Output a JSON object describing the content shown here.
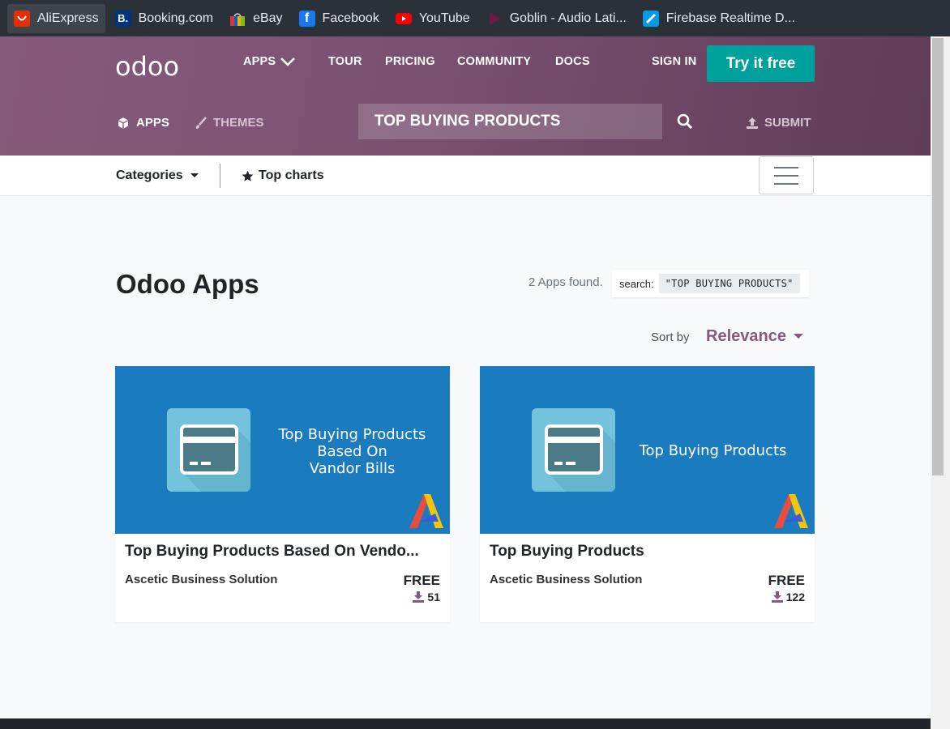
{
  "bookmarks": [
    {
      "label": "AliExpress",
      "icon": "aliexpress-icon",
      "color": "#e62e04"
    },
    {
      "label": "Booking.com",
      "icon": "booking-icon",
      "color": "#003580"
    },
    {
      "label": "eBay",
      "icon": "ebay-icon",
      "color": "#e53238"
    },
    {
      "label": "Facebook",
      "icon": "facebook-icon",
      "color": "#1877f2"
    },
    {
      "label": "YouTube",
      "icon": "youtube-icon",
      "color": "#ff0000"
    },
    {
      "label": "Goblin - Audio Lati...",
      "icon": "goblin-icon",
      "color": "#7b1f4f"
    },
    {
      "label": "Firebase Realtime D...",
      "icon": "firebase-icon",
      "color": "#039be5"
    }
  ],
  "header": {
    "logo": "odoo",
    "nav": {
      "apps": "APPS",
      "tour": "TOUR",
      "pricing": "PRICING",
      "community": "COMMUNITY",
      "docs": "DOCS",
      "sign_in": "SIGN IN"
    },
    "try_button": "Try it free",
    "subnav": {
      "apps": "APPS",
      "themes": "THEMES",
      "submit": "SUBMIT"
    },
    "search_value": "TOP BUYING PRODUCTS",
    "accent": "#875a7b"
  },
  "toolbar": {
    "categories": "Categories",
    "top_charts": "Top charts"
  },
  "main": {
    "title": "Odoo Apps",
    "found": "2 Apps found.",
    "search_label": "search:",
    "search_term": "\"TOP BUYING PRODUCTS\"",
    "sort_by": "Sort by",
    "sort_value": "Relevance"
  },
  "apps": [
    {
      "image_lines": [
        "Top Buying Products",
        "Based On",
        "Vandor Bills"
      ],
      "title": "Top Buying Products Based On Vendo...",
      "vendor": "Ascetic Business Solution",
      "price": "FREE",
      "downloads": "51"
    },
    {
      "image_lines": [
        "Top Buying Products"
      ],
      "title": "Top Buying Products",
      "vendor": "Ascetic Business Solution",
      "price": "FREE",
      "downloads": "122"
    }
  ]
}
